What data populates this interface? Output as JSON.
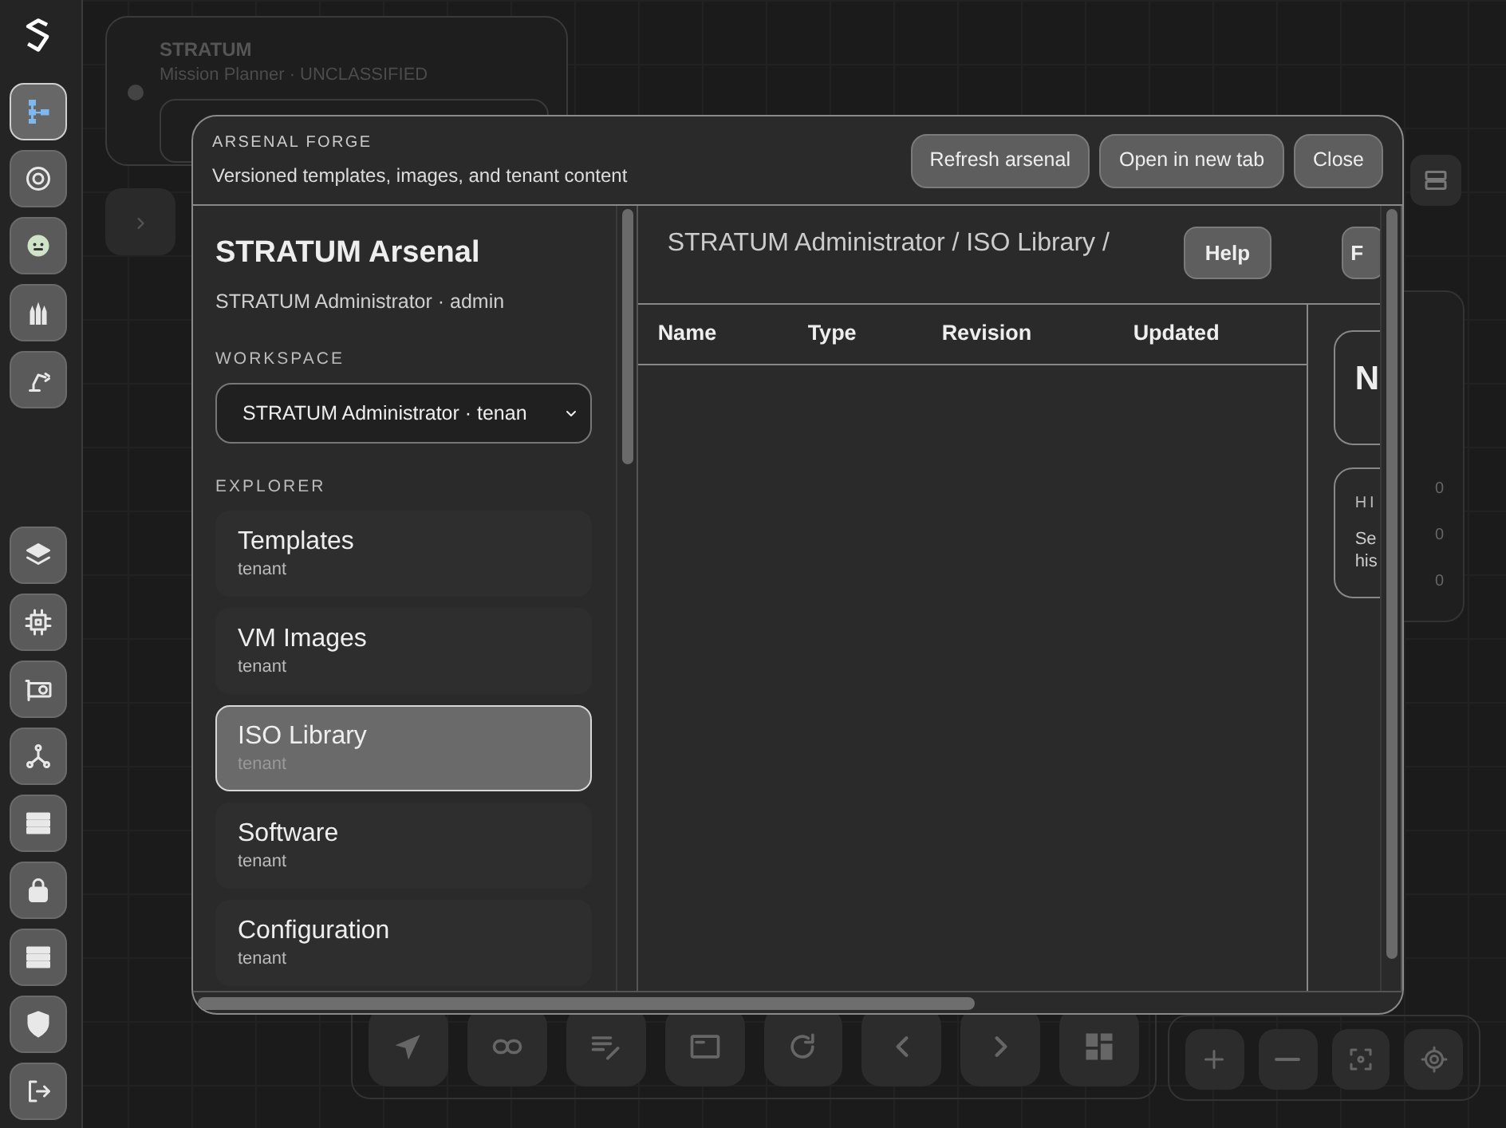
{
  "app": {
    "rail": [
      {
        "selected": true
      },
      {
        "selected": false
      },
      {
        "selected": false
      },
      {
        "selected": false
      },
      {
        "selected": false
      },
      {
        "selected": false
      },
      {
        "selected": false
      },
      {
        "selected": false
      },
      {
        "selected": false
      },
      {
        "selected": false
      },
      {
        "selected": false
      },
      {
        "selected": false
      },
      {
        "selected": false
      },
      {
        "selected": false
      }
    ],
    "brief": {
      "title": "STRATUM",
      "subtitle": "Mission Planner · UNCLASSIFIED"
    },
    "stats": [
      "0",
      "0",
      "0"
    ]
  },
  "dialog": {
    "eyebrow": "ARSENAL FORGE",
    "subtitle": "Versioned templates, images, and tenant content",
    "buttons": [
      "Refresh arsenal",
      "Open in new tab",
      "Close"
    ],
    "sidebar": {
      "title": "STRATUM Arsenal",
      "user": "STRATUM Administrator · admin",
      "workspace_label": "WORKSPACE",
      "workspace": "STRATUM Administrator · tenan",
      "explorer_label": "EXPLORER",
      "items": [
        {
          "label": "Templates",
          "sub": "tenant",
          "selected": false
        },
        {
          "label": "VM Images",
          "sub": "tenant",
          "selected": false
        },
        {
          "label": "ISO Library",
          "sub": "tenant",
          "selected": true
        },
        {
          "label": "Software",
          "sub": "tenant",
          "selected": false
        },
        {
          "label": "Configuration",
          "sub": "tenant",
          "selected": false
        }
      ]
    },
    "breadcrumb": "STRATUM Administrator / ISO Library /",
    "actions": [
      "Help",
      "F"
    ],
    "table": {
      "columns": [
        "Name",
        "Type",
        "Revision",
        "Updated"
      ]
    },
    "detail": {
      "title": "N",
      "section_label": "HI",
      "text": [
        "Se",
        "his"
      ]
    }
  }
}
